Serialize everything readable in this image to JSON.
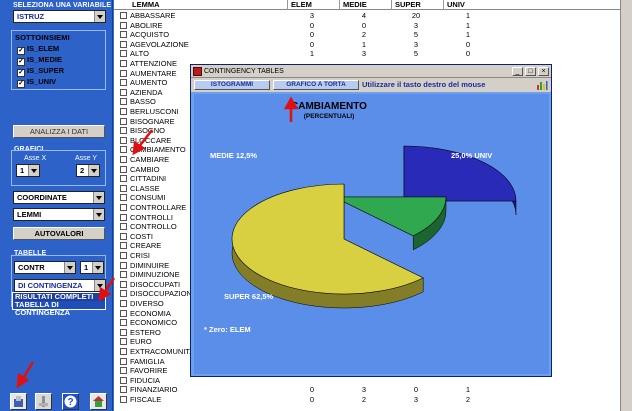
{
  "left": {
    "select_label": "SELEZIONA UNA VARIABILE",
    "variable": "ISTRUZ",
    "subsets_title": "SOTTOINSIEMI",
    "subsets": [
      {
        "label": "IS_ELEM",
        "checked": true
      },
      {
        "label": "IS_MEDIE",
        "checked": true
      },
      {
        "label": "IS_SUPER",
        "checked": true
      },
      {
        "label": "IS_UNIV",
        "checked": true
      }
    ],
    "analyze_button": "ANALIZZA I DATI",
    "graphs_label": "GRAFICI",
    "axis_x_label": "Asse X",
    "axis_x_value": "1",
    "axis_y_label": "Asse Y",
    "axis_y_value": "2",
    "coord_select": "COORDINATE",
    "lemmi_select": "LEMMI",
    "autovalori_button": "AUTOVALORI",
    "tables_label": "TABELLE",
    "tables_select": "CONTR",
    "tables_num": "1",
    "dropdown_value": "DI CONTINGENZA",
    "dropdown_options": [
      "RISULTATI COMPLETI",
      "TABELLA DI CONTINGENZA"
    ]
  },
  "table": {
    "headers": [
      "LEMMA",
      "ELEM",
      "MEDIE",
      "SUPER",
      "UNIV"
    ],
    "rows": [
      [
        "ABBASSARE",
        "3",
        "4",
        "20",
        "1"
      ],
      [
        "ABOLIRE",
        "0",
        "0",
        "3",
        "1"
      ],
      [
        "ACQUISTO",
        "0",
        "2",
        "5",
        "1"
      ],
      [
        "AGEVOLAZIONE",
        "0",
        "1",
        "3",
        "0"
      ],
      [
        "ALTO",
        "1",
        "3",
        "5",
        "0"
      ],
      [
        "ATTENZIONE",
        "",
        "",
        "",
        ""
      ],
      [
        "AUMENTARE",
        "",
        "",
        "",
        ""
      ],
      [
        "AUMENTO",
        "",
        "",
        "",
        ""
      ],
      [
        "AZIENDA",
        "",
        "",
        "",
        ""
      ],
      [
        "BASSO",
        "",
        "",
        "",
        ""
      ],
      [
        "BERLUSCONI",
        "",
        "",
        "",
        ""
      ],
      [
        "BISOGNARE",
        "",
        "",
        "",
        ""
      ],
      [
        "BISOGNO",
        "",
        "",
        "",
        ""
      ],
      [
        "BLOCCARE",
        "",
        "",
        "",
        ""
      ],
      [
        "CAMBIAMENTO",
        "",
        "",
        "",
        ""
      ],
      [
        "CAMBIARE",
        "",
        "",
        "",
        ""
      ],
      [
        "CAMBIO",
        "",
        "",
        "",
        ""
      ],
      [
        "CITTADINI",
        "",
        "",
        "",
        ""
      ],
      [
        "CLASSE",
        "",
        "",
        "",
        ""
      ],
      [
        "CONSUMI",
        "",
        "",
        "",
        ""
      ],
      [
        "CONTROLLARE",
        "",
        "",
        "",
        ""
      ],
      [
        "CONTROLLI",
        "",
        "",
        "",
        ""
      ],
      [
        "CONTROLLO",
        "",
        "",
        "",
        ""
      ],
      [
        "COSTI",
        "",
        "",
        "",
        ""
      ],
      [
        "CREARE",
        "",
        "",
        "",
        ""
      ],
      [
        "CRISI",
        "",
        "",
        "",
        ""
      ],
      [
        "DIMINUIRE",
        "",
        "",
        "",
        ""
      ],
      [
        "DIMINUZIONE",
        "",
        "",
        "",
        ""
      ],
      [
        "DISOCCUPATI",
        "",
        "",
        "",
        ""
      ],
      [
        "DISOCCUPAZIONE",
        "",
        "",
        "",
        ""
      ],
      [
        "DIVERSO",
        "",
        "",
        "",
        ""
      ],
      [
        "ECONOMIA",
        "",
        "",
        "",
        ""
      ],
      [
        "ECONOMICO",
        "",
        "",
        "",
        ""
      ],
      [
        "ESTERO",
        "",
        "",
        "",
        ""
      ],
      [
        "EURO",
        "",
        "",
        "",
        ""
      ],
      [
        "EXTRACOMUNITARI",
        "",
        "",
        "",
        ""
      ],
      [
        "FAMIGLIA",
        "",
        "",
        "",
        ""
      ],
      [
        "FAVORIRE",
        "",
        "",
        "",
        ""
      ],
      [
        "FIDUCIA",
        "",
        "",
        "",
        ""
      ],
      [
        "FINANZIARIO",
        "0",
        "3",
        "0",
        "1"
      ],
      [
        "FISCALE",
        "0",
        "2",
        "3",
        "2"
      ]
    ]
  },
  "dialog": {
    "title": "CONTINGENCY TABLES",
    "tab_histograms": "ISTOGRAMMI",
    "tab_pie": "GRAFICO A TORTA",
    "hint": "Utilizzare il tasto destro del mouse",
    "zero_note": "* Zero: ELEM",
    "slice_colors": {
      "UNIV": "#2a2ab8",
      "MEDIE": "#30a850",
      "SUPER": "#d8d040"
    }
  },
  "chart_data": {
    "type": "pie",
    "title": "CAMBIAMENTO",
    "subtitle": "(PERCENTUALI)",
    "categories": [
      "UNIV",
      "MEDIE",
      "SUPER"
    ],
    "values": [
      25.0,
      12.5,
      62.5
    ],
    "labels": [
      "25,0% UNIV",
      "MEDIE 12,5%",
      "SUPER 62,5%"
    ]
  }
}
